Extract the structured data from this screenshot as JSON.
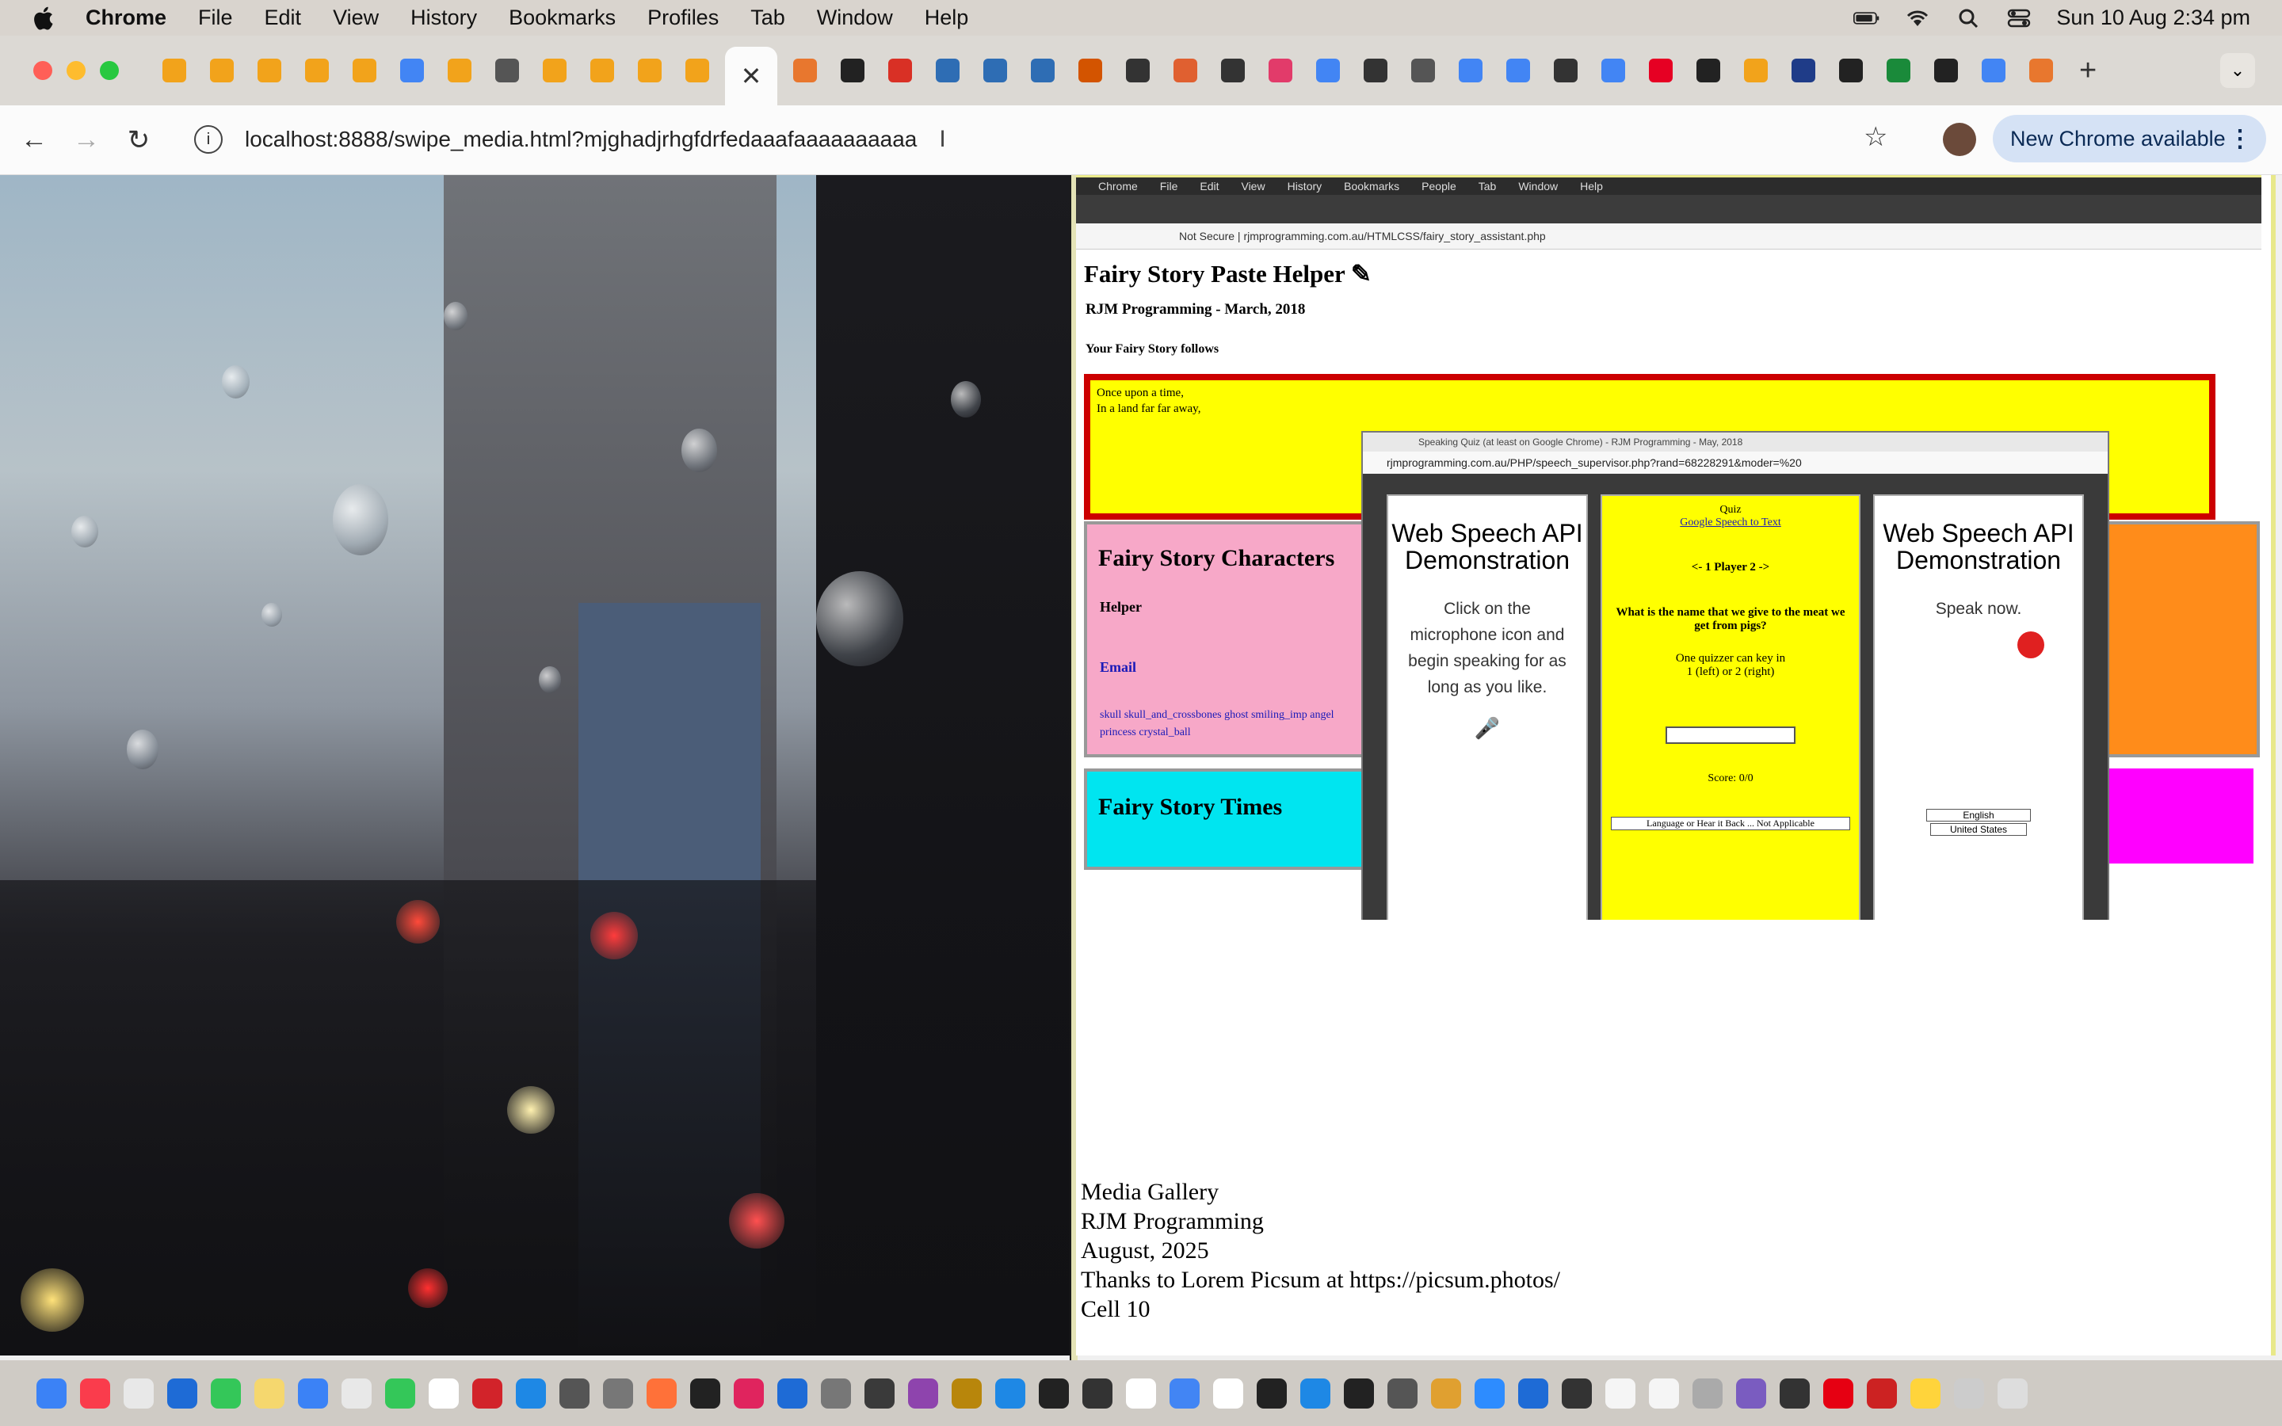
{
  "menubar": {
    "app": "Chrome",
    "items": [
      "File",
      "Edit",
      "View",
      "History",
      "Bookmarks",
      "Profiles",
      "Tab",
      "Window",
      "Help"
    ],
    "clock": "Sun 10 Aug  2:34 pm"
  },
  "tabs": {
    "favicon_colors": [
      "#f2a31b",
      "#f2a31b",
      "#f2a31b",
      "#f2a31b",
      "#f2a31b",
      "#4285f4",
      "#f2a31b",
      "#555555",
      "#f2a31b",
      "#f2a31b",
      "#f2a31b",
      "#f2a31b"
    ],
    "after_colors": [
      "#e8772e",
      "#222222",
      "#d93025",
      "#2e6db4",
      "#2e6db4",
      "#2e6db4",
      "#d35400",
      "#333333",
      "#e06030",
      "#333333",
      "#e23b6a",
      "#4285f4",
      "#333333",
      "#555555",
      "#4285f4",
      "#4285f4",
      "#333333",
      "#4285f4",
      "#e60023",
      "#222222",
      "#f2a31b",
      "#1f3c88",
      "#222222",
      "#1a8a3a",
      "#222222",
      "#4285f4",
      "#e8772e"
    ]
  },
  "toolbar": {
    "url": "localhost:8888/swipe_media.html?mjghadjrhgfdrfedaaafaaaaaaaaaa",
    "update_label": "New Chrome available"
  },
  "nested": {
    "menu": [
      "Chrome",
      "File",
      "Edit",
      "View",
      "History",
      "Bookmarks",
      "People",
      "Tab",
      "Window",
      "Help"
    ],
    "url": "Not Secure  |  rjmprogramming.com.au/HTMLCSS/fairy_story_assistant.php",
    "title": "Fairy Story Paste Helper",
    "byline": "RJM Programming - March, 2018",
    "follows": "Your Fairy Story follows",
    "story": "Once upon a time,\nIn a land far far away,",
    "characters_title": "Fairy Story Characters",
    "helper": "Helper",
    "email": "Email",
    "emoji_line": "skull  skull_and_crossbones  ghost  smiling_imp  angel  princess  crystal_ball",
    "times_title": "Fairy Story Times",
    "popup_title": "Speaking Quiz (at least on Google Chrome) - RJM Programming - May, 2018",
    "popup_url": "rjmprogramming.com.au/PHP/speech_supervisor.php?rand=68228291&moder=%20",
    "web_speech": "Web Speech API Demonstration",
    "left_desc": "Click on the microphone icon and begin speaking for as long as you like.",
    "right_desc": "Speak now.",
    "quiz_label": "Quiz",
    "google_link": "Google Speech to Text",
    "player": "<- 1 Player 2 ->",
    "question": "What is the name that we give to the meat we get from pigs?",
    "instruction": "One quizzer can key in 1 (left) or 2 (right)",
    "score": "Score: 0/0",
    "lang_select": "Language or Hear it Back ... Not Applicable",
    "english": "English",
    "country": "United States"
  },
  "gallery": {
    "lines": [
      "Media Gallery",
      "RJM Programming",
      "August, 2025",
      "Thanks to Lorem Picsum at https://picsum.photos/",
      "Cell 10"
    ]
  },
  "dock": {
    "colors": [
      "#3b82f6",
      "#fa3c4c",
      "#e8e8e8",
      "#1e6bd6",
      "#34c759",
      "#f5d76e",
      "#3b82f6",
      "#e8e8e8",
      "#34c759",
      "#ffffff",
      "#d2232a",
      "#1e88e5",
      "#555555",
      "#777777",
      "#ff7139",
      "#222222",
      "#e0245e",
      "#1e6bd6",
      "#777777",
      "#3a3a3a",
      "#8e44ad",
      "#b8860b",
      "#1e88e5",
      "#222222",
      "#333333",
      "#ffffff",
      "#4285f4",
      "#ffffff",
      "#222222",
      "#1e88e5",
      "#222222",
      "#555555",
      "#e0a030",
      "#2d8cff",
      "#1e6bd6",
      "#333333",
      "#f5f5f5",
      "#f5f5f5",
      "#aaaaaa",
      "#7a5cc0",
      "#333333",
      "#e60012",
      "#cc2222",
      "#ffd43b",
      "#cccccc",
      "#dddddd"
    ]
  }
}
